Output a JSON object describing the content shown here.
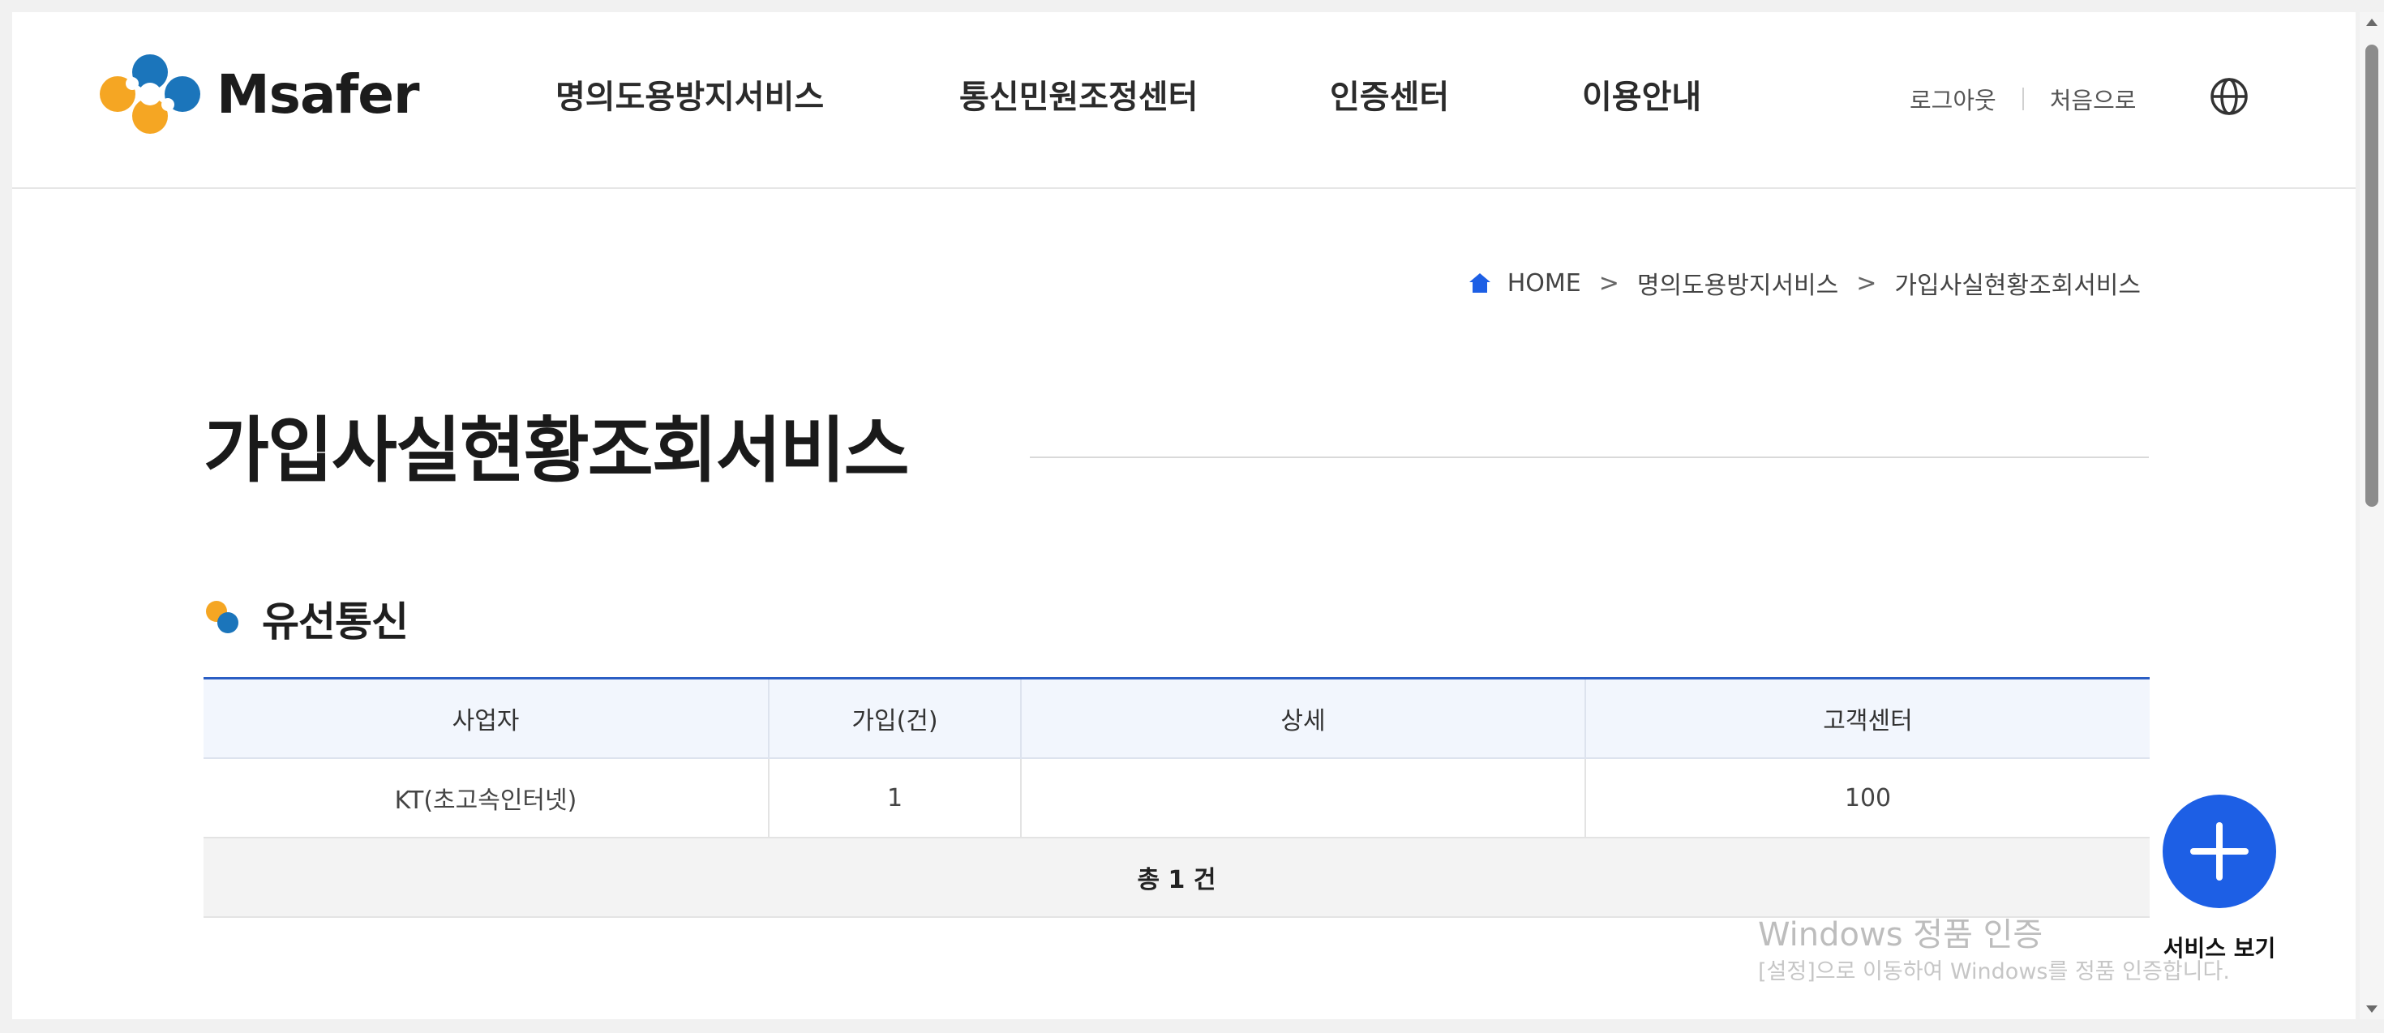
{
  "header": {
    "logo_text": "Msafer",
    "nav": [
      {
        "label": "명의도용방지서비스"
      },
      {
        "label": "통신민원조정센터"
      },
      {
        "label": "인증센터"
      },
      {
        "label": "이용안내"
      }
    ],
    "logout_label": "로그아웃",
    "home_label": "처음으로",
    "language_icon": "globe-icon"
  },
  "breadcrumb": {
    "home_icon": "home-icon",
    "items": [
      "HOME",
      "명의도용방지서비스",
      "가입사실현황조회서비스"
    ],
    "separator": ">"
  },
  "page": {
    "title": "가입사실현황조회서비스"
  },
  "section": {
    "title": "유선통신",
    "table": {
      "columns": [
        "사업자",
        "가입(건)",
        "상세",
        "고객센터"
      ],
      "rows": [
        {
          "provider": "KT(초고속인터넷)",
          "count": "1",
          "detail": "",
          "service_center": "100"
        }
      ],
      "total": "총 1 건"
    }
  },
  "fab": {
    "icon": "plus-icon",
    "label": "서비스 보기"
  },
  "watermark": {
    "title": "Windows 정품 인증",
    "subtitle": "[설정]으로 이동하여 Windows를 정품 인증합니다."
  },
  "colors": {
    "accent_blue": "#1d5fe5",
    "table_border": "#2b5ec4",
    "logo_orange": "#f5a623",
    "logo_blue": "#1b75bb"
  }
}
